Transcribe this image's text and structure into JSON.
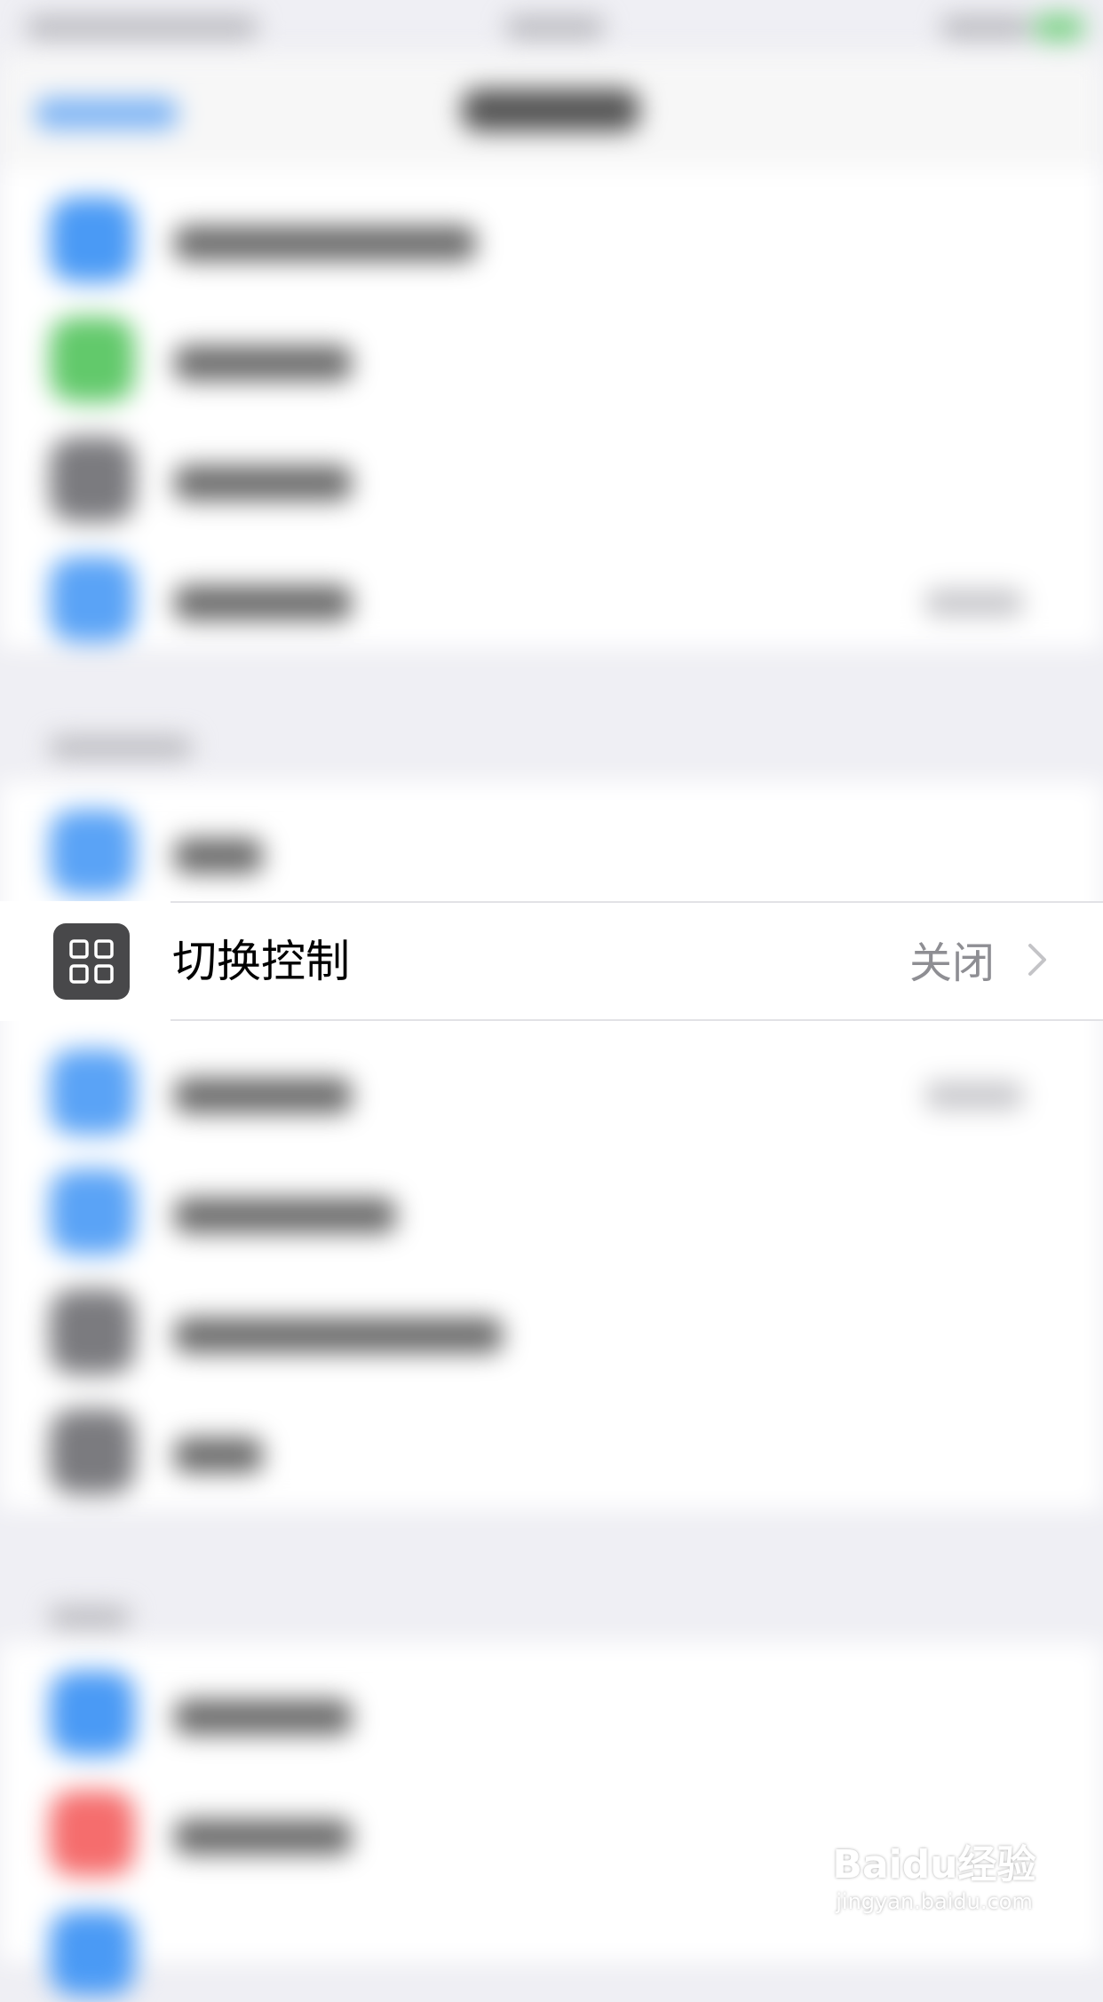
{
  "setting_row": {
    "label": "切换控制",
    "value": "关闭",
    "icon": "switch-control-grid-icon",
    "icon_color": "#48484a"
  },
  "watermark": {
    "brand": "Baidu经验",
    "url": "jingyan.baidu.com"
  },
  "colors": {
    "background": "#efeff4",
    "row_background": "#ffffff",
    "value_text": "#8e8e93",
    "separator": "#e2e2e6"
  }
}
